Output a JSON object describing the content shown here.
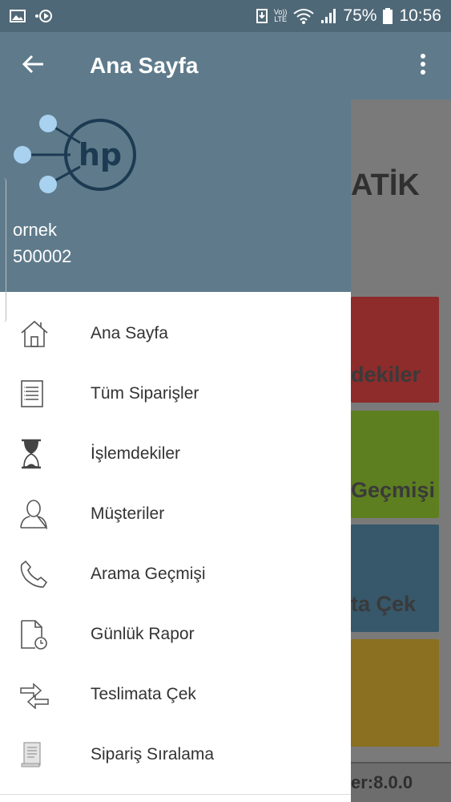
{
  "status_bar": {
    "battery": "75%",
    "time": "10:56",
    "network": "LTE",
    "volte": "Vo))"
  },
  "toolbar": {
    "title": "Ana Sayfa"
  },
  "drawer": {
    "user_name": "ornek",
    "user_id": "500002",
    "logo_text": "hp",
    "items": [
      {
        "label": "Ana Sayfa",
        "icon": "home-icon"
      },
      {
        "label": "Tüm Siparişler",
        "icon": "list-document-icon"
      },
      {
        "label": "İşlemdekiler",
        "icon": "hourglass-icon"
      },
      {
        "label": "Müşteriler",
        "icon": "user-icon"
      },
      {
        "label": "Arama Geçmişi",
        "icon": "phone-icon"
      },
      {
        "label": "Günlük Rapor",
        "icon": "report-clock-icon"
      },
      {
        "label": "Teslimata Çek",
        "icon": "transfer-arrows-icon"
      },
      {
        "label": "Sipariş Sıralama",
        "icon": "receipt-icon"
      }
    ]
  },
  "background_page": {
    "title_fragment": "ATİK",
    "tiles": [
      {
        "label_fragment": "dekiler",
        "color": "#8e2b2b"
      },
      {
        "label_fragment": "Geçmişi",
        "color": "#5d7f20"
      },
      {
        "label_fragment": "ta Çek",
        "color": "#37576a"
      },
      {
        "label_fragment": "",
        "color": "#8a7020"
      }
    ],
    "version_fragment": "er:8.0.0"
  },
  "colors": {
    "header": "#5f7b8b",
    "status_bar": "#4f6877",
    "drawer_bg": "#ffffff",
    "text": "#333333"
  }
}
